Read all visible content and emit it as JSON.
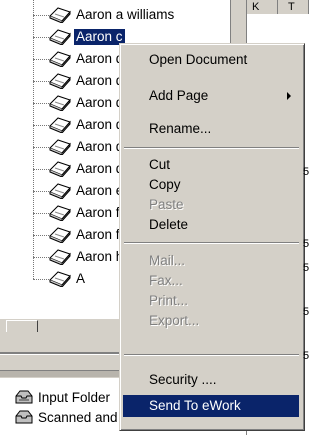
{
  "tree": {
    "items": [
      {
        "label": "Aaron a williams",
        "selected": false
      },
      {
        "label": "Aaron c",
        "selected": true
      },
      {
        "label": "Aaron d",
        "selected": false
      },
      {
        "label": "Aaron d",
        "selected": false
      },
      {
        "label": "Aaron d",
        "selected": false
      },
      {
        "label": "Aaron d",
        "selected": false
      },
      {
        "label": "Aaron d",
        "selected": false
      },
      {
        "label": "Aaron d",
        "selected": false
      },
      {
        "label": "Aaron e",
        "selected": false
      },
      {
        "label": "Aaron f",
        "selected": false
      },
      {
        "label": "Aaron f",
        "selected": false
      },
      {
        "label": "Aaron h",
        "selected": false
      },
      {
        "label": "A",
        "selected": false
      }
    ]
  },
  "folders": [
    {
      "label": "Input Folder",
      "icon": "inbox-tray-icon"
    },
    {
      "label": "Scanned and Printed",
      "icon": "folder-tray-icon"
    }
  ],
  "menu": {
    "open_document": "Open Document",
    "add_page": "Add Page",
    "rename": "Rename...",
    "cut": "Cut",
    "copy": "Copy",
    "paste": "Paste",
    "delete": "Delete",
    "mail": "Mail...",
    "fax": "Fax...",
    "print": "Print...",
    "export": "Export...",
    "security": "Security ....",
    "send_to_ework": "Send To eWork"
  },
  "columns": {
    "mark_k": "K",
    "mark_t": "T",
    "mark_5": "5"
  },
  "colors": {
    "selection": "#0a246a",
    "face": "#d4d0c8"
  }
}
